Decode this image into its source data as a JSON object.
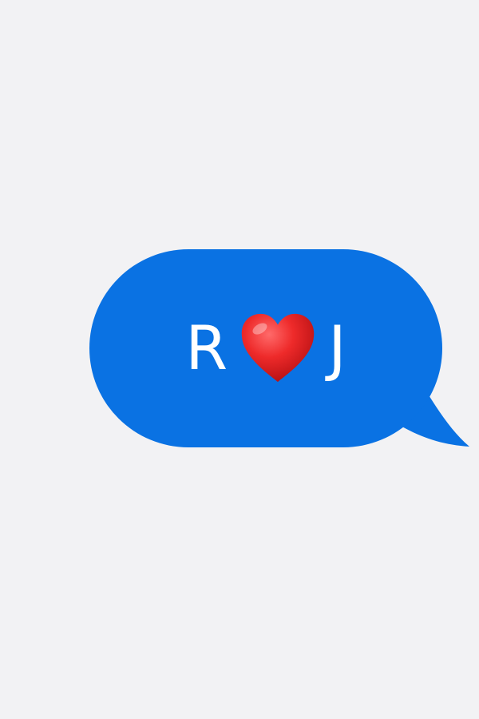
{
  "message": {
    "first_letter": "R",
    "second_letter": "J",
    "emoji_icon": "red-heart-icon"
  },
  "colors": {
    "background": "#f2f2f4",
    "bubble": "#0a72e3",
    "text": "#ffffff",
    "heart": "#e11f1f"
  }
}
